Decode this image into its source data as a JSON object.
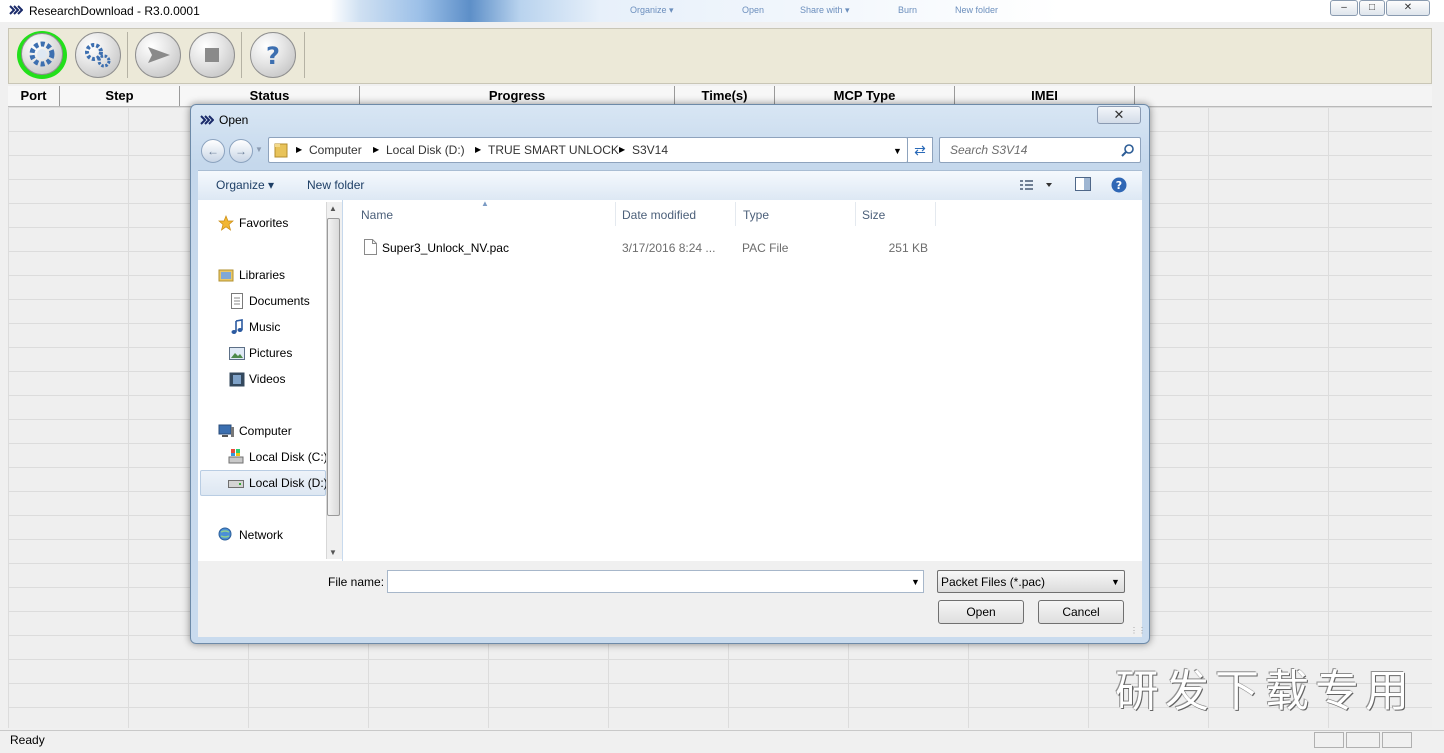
{
  "app": {
    "title": "ResearchDownload - R3.0.0001"
  },
  "background_window": {
    "menu": [
      "Organize ▾",
      "Open",
      "Share with ▾",
      "Burn",
      "New folder"
    ]
  },
  "window_controls": {
    "minimize": "–",
    "maximize": "□",
    "close": "✕"
  },
  "toolbar": {
    "buttons": [
      "load-packet",
      "settings",
      "start",
      "stop",
      "help"
    ],
    "highlight_color": "#22e01a"
  },
  "grid": {
    "columns": [
      "Port",
      "Step",
      "Status",
      "Progress",
      "Time(s)",
      "MCP Type",
      "IMEI"
    ]
  },
  "statusbar": {
    "text": "Ready"
  },
  "watermark": "研发下载专用",
  "dialog": {
    "title": "Open",
    "close_label": "✕",
    "breadcrumb": [
      "Computer",
      "Local Disk (D:)",
      "TRUE SMART UNLOCK",
      "S3V14"
    ],
    "search_placeholder": "Search S3V14",
    "commands": {
      "organize": "Organize ▾",
      "new_folder": "New folder"
    },
    "nav": {
      "favorites": "Favorites",
      "libraries": "Libraries",
      "library_items": [
        "Documents",
        "Music",
        "Pictures",
        "Videos"
      ],
      "computer": "Computer",
      "drives": [
        "Local Disk (C:)",
        "Local Disk (D:)"
      ],
      "network": "Network"
    },
    "file_columns": [
      "Name",
      "Date modified",
      "Type",
      "Size"
    ],
    "files": [
      {
        "name": "Super3_Unlock_NV.pac",
        "date": "3/17/2016 8:24 ...",
        "type": "PAC File",
        "size": "251 KB"
      }
    ],
    "filename_label": "File name:",
    "filename_value": "",
    "filter": "Packet Files (*.pac)",
    "open_label": "Open",
    "cancel_label": "Cancel"
  }
}
